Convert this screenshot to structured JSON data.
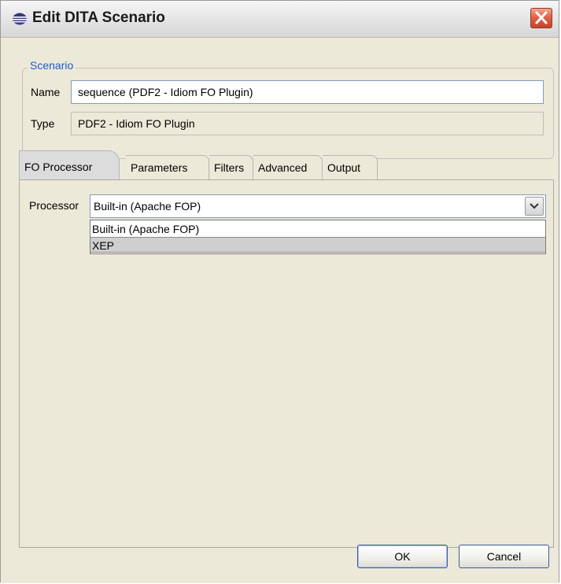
{
  "window": {
    "title": "Edit DITA Scenario"
  },
  "scenario": {
    "legend": "Scenario",
    "name_label": "Name",
    "name_value": "sequence (PDF2 - Idiom FO Plugin)",
    "type_label": "Type",
    "type_value": "PDF2 - Idiom FO Plugin"
  },
  "tabs": [
    {
      "label": "FO Processor",
      "active": true
    },
    {
      "label": "Parameters",
      "active": false
    },
    {
      "label": "Filters",
      "active": false
    },
    {
      "label": "Advanced",
      "active": false
    },
    {
      "label": "Output",
      "active": false
    }
  ],
  "fo_processor": {
    "processor_label": "Processor",
    "selected_value": "Built-in (Apache FOP)",
    "options": [
      {
        "label": "Built-in (Apache FOP)",
        "highlighted": false
      },
      {
        "label": "XEP",
        "highlighted": true
      }
    ]
  },
  "buttons": {
    "ok": "OK",
    "cancel": "Cancel"
  },
  "colors": {
    "dialog_bg": "#ece9d8",
    "legend_text": "#1d5ad6",
    "close_button": "#e0624a"
  }
}
